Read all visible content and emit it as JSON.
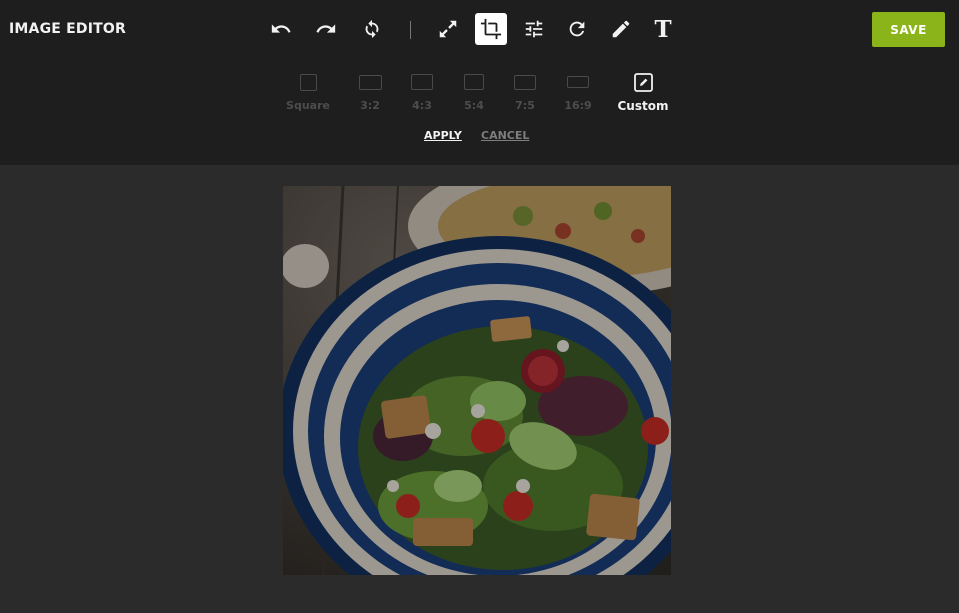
{
  "app": {
    "title": "IMAGE EDITOR"
  },
  "toolbar": {
    "tools": [
      {
        "name": "undo-icon",
        "active": false
      },
      {
        "name": "redo-icon",
        "active": false
      },
      {
        "name": "reset-icon",
        "active": false
      },
      {
        "name": "resize-icon",
        "active": false
      },
      {
        "name": "crop-icon",
        "active": true
      },
      {
        "name": "adjust-icon",
        "active": false
      },
      {
        "name": "rotate-icon",
        "active": false
      },
      {
        "name": "draw-icon",
        "active": false
      },
      {
        "name": "text-icon",
        "active": false
      }
    ],
    "text_tool_glyph": "T",
    "save_label": "SAVE"
  },
  "crop": {
    "ratios": [
      {
        "label": "Square",
        "selected": false
      },
      {
        "label": "3:2",
        "selected": false
      },
      {
        "label": "4:3",
        "selected": false
      },
      {
        "label": "5:4",
        "selected": false
      },
      {
        "label": "7:5",
        "selected": false
      },
      {
        "label": "16:9",
        "selected": false
      },
      {
        "label": "Custom",
        "selected": true
      }
    ],
    "apply_label": "APPLY",
    "cancel_label": "CANCEL"
  },
  "colors": {
    "background": "#2b2b2b",
    "topbar": "#1e1e1e",
    "accent": "#8ab419"
  }
}
